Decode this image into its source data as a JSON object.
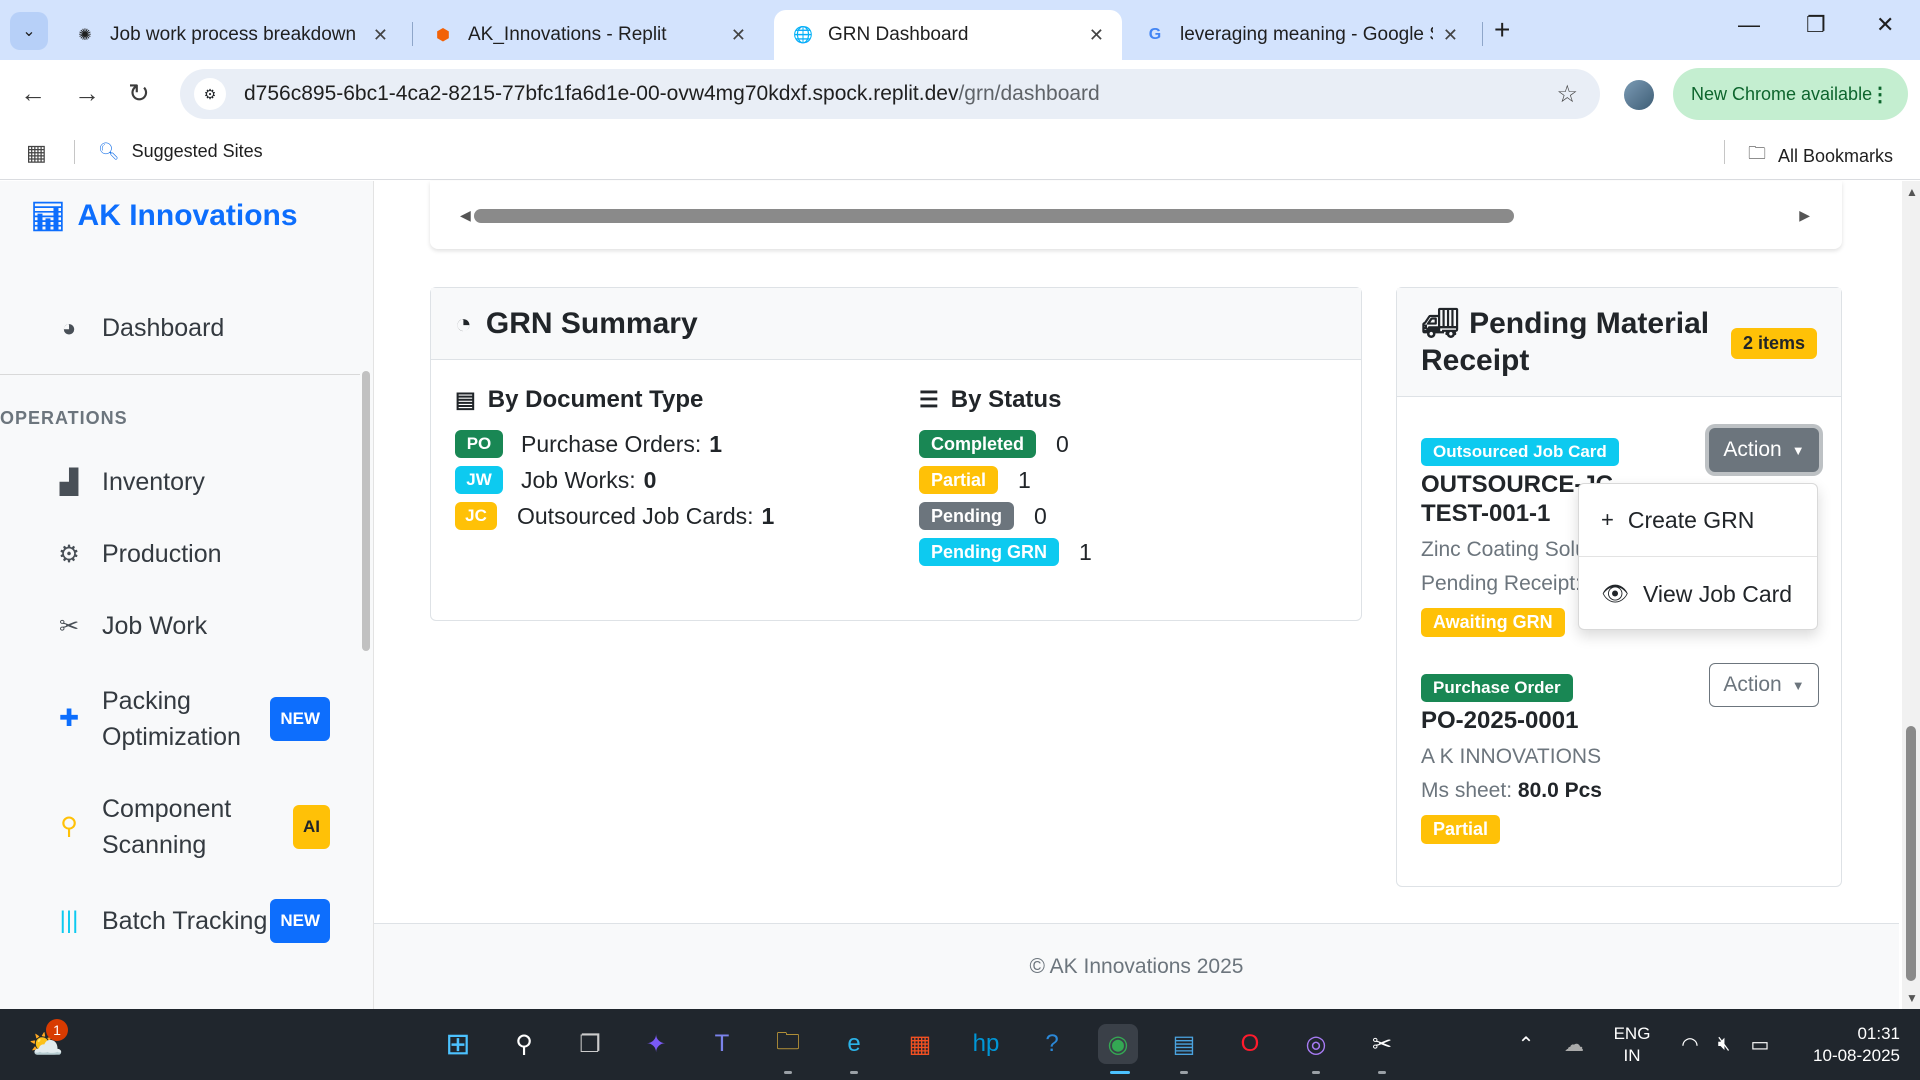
{
  "browser": {
    "tabs": [
      {
        "title": "Job work process breakdown",
        "icon": "chatgpt-icon"
      },
      {
        "title": "AK_Innovations - Replit",
        "icon": "replit-icon"
      },
      {
        "title": "GRN Dashboard",
        "icon": "globe-icon"
      },
      {
        "title": "leveraging meaning - Google S",
        "icon": "google-icon"
      }
    ],
    "url_host": "d756c895-6bc1-4ca2-8215-77bfc1fa6d1e-00-ovw4mg70kdxf.spock.replit.dev",
    "url_path": "/grn/dashboard",
    "update_label": "New Chrome available",
    "bookmarks": {
      "suggested": "Suggested Sites",
      "all": "All Bookmarks"
    }
  },
  "sidebar": {
    "brand": "AK Innovations",
    "dashboard": "Dashboard",
    "section_heading": "OPERATIONS",
    "items": [
      {
        "label": "Inventory",
        "icon": "inventory-icon"
      },
      {
        "label": "Production",
        "icon": "gears-icon"
      },
      {
        "label": "Job Work",
        "icon": "tools-icon"
      },
      {
        "label": "Packing Optimization",
        "badge": "NEW",
        "icon": "puzzle-icon"
      },
      {
        "label": "Component Scanning",
        "badge": "AI",
        "icon": "search-icon"
      },
      {
        "label": "Batch Tracking",
        "badge": "NEW",
        "icon": "barcode-icon"
      }
    ]
  },
  "summary": {
    "title": "GRN Summary",
    "by_document_type": {
      "title": "By Document Type",
      "rows": [
        {
          "badge": "PO",
          "label": "Purchase Orders:",
          "value": "1",
          "color": "#198754"
        },
        {
          "badge": "JW",
          "label": "Job Works:",
          "value": "0",
          "color": "#0dcaf0"
        },
        {
          "badge": "JC",
          "label": "Outsourced Job Cards:",
          "value": "1",
          "color": "#ffc107"
        }
      ]
    },
    "by_status": {
      "title": "By Status",
      "rows": [
        {
          "badge": "Completed",
          "value": "0",
          "color": "#198754"
        },
        {
          "badge": "Partial",
          "value": "1",
          "color": "#ffc107"
        },
        {
          "badge": "Pending",
          "value": "0",
          "color": "#6c757d"
        },
        {
          "badge": "Pending GRN",
          "value": "1",
          "color": "#0dcaf0"
        }
      ]
    }
  },
  "pending": {
    "title": "Pending Material Receipt",
    "count_badge": "2 items",
    "items": [
      {
        "type": "Outsourced Job Card",
        "code": "OUTSOURCE-JC-TEST-001-1",
        "line1": "Zinc Coating Solu",
        "line2": "Pending Receipt:",
        "state": "Awaiting GRN",
        "action": "Action"
      },
      {
        "type": "Purchase Order",
        "code": "PO-2025-0001",
        "line1": "A K INNOVATIONS",
        "line2_label": "Ms sheet:",
        "line2_value": "80.0 Pcs",
        "state": "Partial",
        "action": "Action"
      }
    ],
    "menu": {
      "create": "Create GRN",
      "view": "View Job Card"
    }
  },
  "footer": "© AK Innovations 2025",
  "taskbar": {
    "weather_badge": "1",
    "lang": "ENG",
    "region": "IN",
    "time": "01:31",
    "date": "10-08-2025"
  },
  "colors": {
    "primary": "#0d6efd",
    "success": "#198754",
    "warning": "#ffc107",
    "info": "#0dcaf0",
    "secondary": "#6c757d"
  }
}
